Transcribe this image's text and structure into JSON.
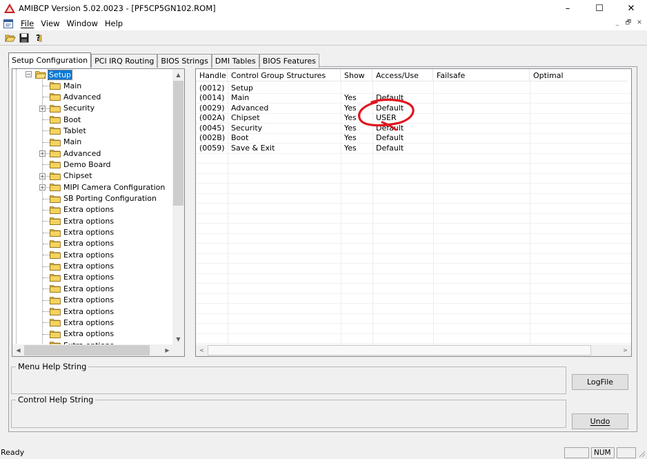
{
  "window": {
    "title": "AMIBCP Version 5.02.0023 - [PF5CP5GN102.ROM]",
    "minimize": "–",
    "maximize": "☐",
    "close": "✕"
  },
  "menu": {
    "items": [
      "File",
      "View",
      "Window",
      "Help"
    ],
    "mdi_min": "_",
    "mdi_restore": "🗗",
    "mdi_close": "✕"
  },
  "toolbar": {
    "icons": [
      "open-folder-icon",
      "save-icon",
      "help-icon"
    ]
  },
  "tabs": [
    "Setup Configuration",
    "PCI IRQ Routing",
    "BIOS Strings",
    "DMI Tables",
    "BIOS Features"
  ],
  "tree": {
    "root": "Setup",
    "items": [
      {
        "label": "Main",
        "expandable": false
      },
      {
        "label": "Advanced",
        "expandable": false
      },
      {
        "label": "Security",
        "expandable": true
      },
      {
        "label": "Boot",
        "expandable": false
      },
      {
        "label": "Tablet",
        "expandable": false
      },
      {
        "label": "Main",
        "expandable": false
      },
      {
        "label": "Advanced",
        "expandable": true
      },
      {
        "label": "Demo Board",
        "expandable": false
      },
      {
        "label": "Chipset",
        "expandable": true
      },
      {
        "label": "MIPI Camera Configuration",
        "expandable": true
      },
      {
        "label": "SB Porting Configuration",
        "expandable": false
      },
      {
        "label": "Extra options",
        "expandable": false
      },
      {
        "label": "Extra options",
        "expandable": false
      },
      {
        "label": "Extra options",
        "expandable": false
      },
      {
        "label": "Extra options",
        "expandable": false
      },
      {
        "label": "Extra options",
        "expandable": false
      },
      {
        "label": "Extra options",
        "expandable": false
      },
      {
        "label": "Extra options",
        "expandable": false
      },
      {
        "label": "Extra options",
        "expandable": false
      },
      {
        "label": "Extra options",
        "expandable": false
      },
      {
        "label": "Extra options",
        "expandable": false
      },
      {
        "label": "Extra options",
        "expandable": false
      },
      {
        "label": "Extra options",
        "expandable": false
      },
      {
        "label": "Extra options",
        "expandable": false
      }
    ]
  },
  "table": {
    "columns": [
      "Handle",
      "Control Group Structures",
      "Show",
      "Access/Use",
      "Failsafe",
      "Optimal"
    ],
    "rows": [
      {
        "handle": "(0012)",
        "name": "Setup",
        "show": "",
        "access": "",
        "failsafe": "",
        "optimal": ""
      },
      {
        "handle": "(0014)",
        "name": "Main",
        "show": "Yes",
        "access": "Default",
        "failsafe": "",
        "optimal": ""
      },
      {
        "handle": "(0029)",
        "name": "Advanced",
        "show": "Yes",
        "access": "Default",
        "failsafe": "",
        "optimal": ""
      },
      {
        "handle": "(002A)",
        "name": "Chipset",
        "show": "Yes",
        "access": "USER",
        "failsafe": "",
        "optimal": ""
      },
      {
        "handle": "(0045)",
        "name": "Security",
        "show": "Yes",
        "access": "Default",
        "failsafe": "",
        "optimal": ""
      },
      {
        "handle": "(002B)",
        "name": "Boot",
        "show": "Yes",
        "access": "Default",
        "failsafe": "",
        "optimal": ""
      },
      {
        "handle": "(0059)",
        "name": "Save & Exit",
        "show": "Yes",
        "access": "Default",
        "failsafe": "",
        "optimal": ""
      }
    ]
  },
  "help": {
    "menu_help_label": "Menu Help String",
    "control_help_label": "Control Help String",
    "logfile_button": "LogFile",
    "undo_button": "Undo"
  },
  "status": {
    "text": "Ready",
    "num": "NUM"
  },
  "colors": {
    "selection": "#0078d7",
    "annotation": "#e0141e"
  }
}
